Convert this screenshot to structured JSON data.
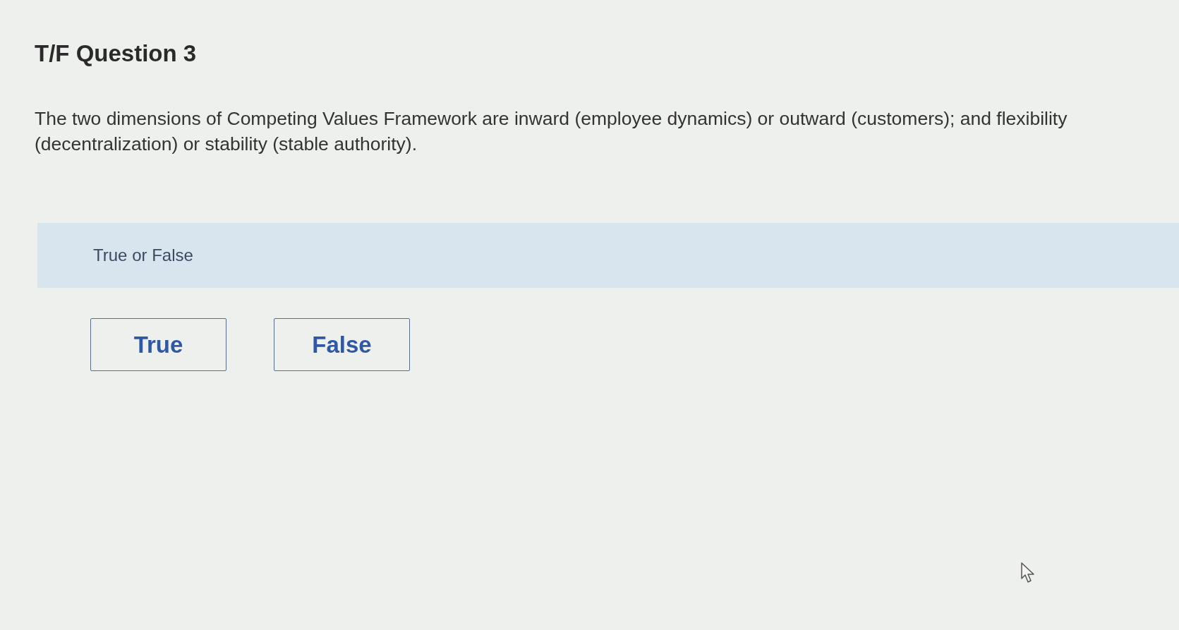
{
  "question": {
    "title": "T/F Question 3",
    "prompt": "The two dimensions of Competing Values Framework are inward (employee dynamics) or outward (customers); and flexibility (decentralization) or stability (stable authority)."
  },
  "answer_panel": {
    "label": "True or False",
    "options": [
      {
        "label": "True",
        "selected": false
      },
      {
        "label": "False",
        "selected": false
      }
    ]
  }
}
